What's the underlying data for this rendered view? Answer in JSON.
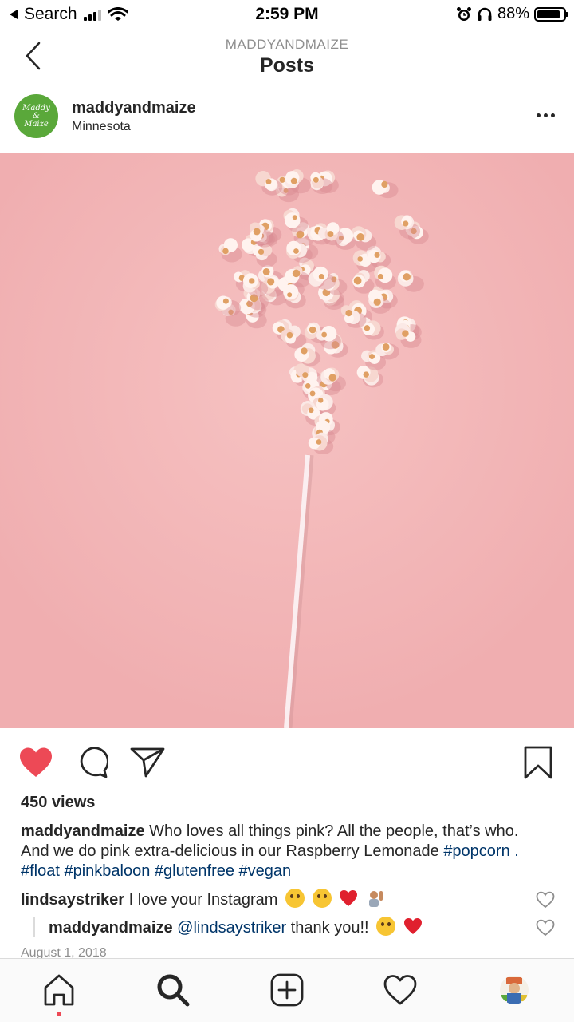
{
  "status_bar": {
    "back_app": "Search",
    "time": "2:59 PM",
    "battery": "88%",
    "battery_level": 0.88
  },
  "nav": {
    "account_handle": "MADDYANDMAIZE",
    "title": "Posts"
  },
  "post": {
    "username": "maddyandmaize",
    "location": "Minnesota",
    "avatar_text": "Maddy & Maize",
    "views": "450 views",
    "caption_user": "maddyandmaize",
    "caption_text": "Who loves all things pink? All the people, that’s who. And we do pink extra-delicious in our Raspberry Lemonade",
    "caption_tags": "#popcorn . #float #pinkbaloon #glutenfree #vegan",
    "date": "August 1, 2018",
    "liked": true
  },
  "comments": [
    {
      "user": "lindsaystriker",
      "text": "I love your Instagram"
    },
    {
      "user": "maddyandmaize",
      "mention": "@lindsaystriker",
      "text": "thank you!!"
    }
  ],
  "colors": {
    "like": "#ed4956",
    "image_bg": "#f0aeb0",
    "avatar": "#5aa83a",
    "hashtag": "#003569"
  },
  "icons": [
    "back-chevron-icon",
    "more-icon",
    "heart-icon",
    "comment-icon",
    "share-icon",
    "bookmark-icon",
    "home-icon",
    "search-icon",
    "add-icon",
    "activity-icon"
  ]
}
